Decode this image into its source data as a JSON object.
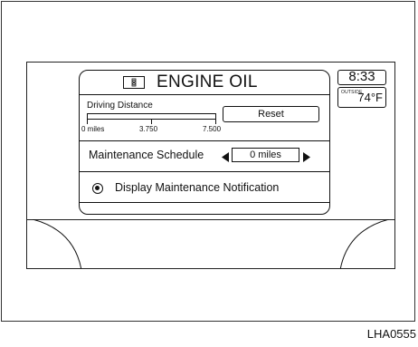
{
  "engine_oil": {
    "title": "ENGINE OIL",
    "icon": "oil-can-icon",
    "driving_distance": {
      "label": "Driving Distance",
      "progress_fraction": 0,
      "tick_labels": [
        "0 miles",
        "3.750",
        "7.500"
      ]
    },
    "reset_label": "Reset",
    "maintenance_schedule": {
      "label": "Maintenance Schedule",
      "value": "0 miles"
    },
    "notification": {
      "label": "Display Maintenance Notification",
      "selected": true
    }
  },
  "status": {
    "clock": "8:33",
    "outside_label": "OUTSIDE",
    "temperature": "74°F"
  },
  "figure_code": "LHA0555",
  "colors": {
    "line": "#111111",
    "background": "#ffffff"
  }
}
